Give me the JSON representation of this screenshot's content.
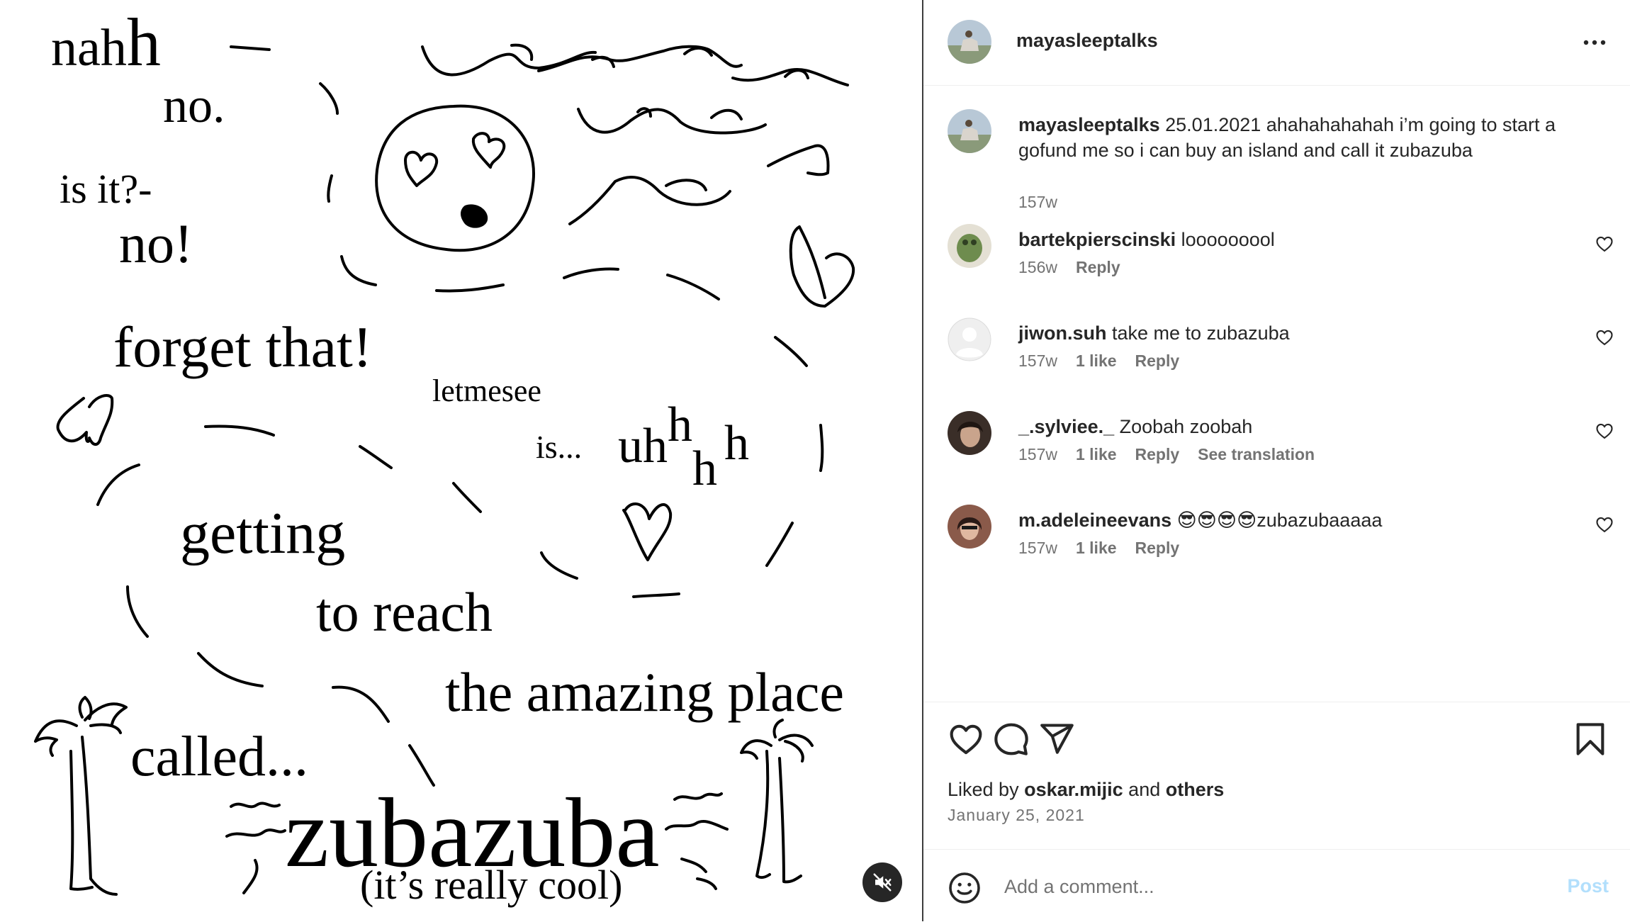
{
  "media": {
    "drawing_text": {
      "nahh_part1": "nah",
      "nahh_part2": "h",
      "no_1": "no.",
      "is_it": "is it?-",
      "no_2": "no!",
      "forget": "forget that!",
      "letmesee": "letmesee",
      "is": "is...",
      "uh_1": "uh",
      "uh_2": "h",
      "uh_3": "h",
      "uh_4": "h",
      "getting": "getting",
      "to_reach": "to reach",
      "amazing": "the amazing place",
      "called": "called...",
      "zubazuba": "zubazuba",
      "cool": "(it’s really cool)"
    },
    "mute_icon": "speaker-muted-icon"
  },
  "header": {
    "username": "mayasleeptalks",
    "more_icon": "more-options-icon"
  },
  "caption": {
    "username": "mayasleeptalks",
    "text": " 25.01.2021 ahahahahahah i’m going to start a gofund me so i can buy an island and call it zubazuba",
    "time": "157w"
  },
  "comments": [
    {
      "username": "bartekpierscinski",
      "text": " looooooool",
      "time": "156w",
      "likes": "",
      "reply": "Reply",
      "translation": ""
    },
    {
      "username": "jiwon.suh",
      "text": " take me to zubazuba",
      "time": "157w",
      "likes": "1 like",
      "reply": "Reply",
      "translation": ""
    },
    {
      "username": "_.sylviee._",
      "text": " Zoobah zoobah",
      "time": "157w",
      "likes": "1 like",
      "reply": "Reply",
      "translation": "See translation"
    },
    {
      "username": "m.adeleineevans",
      "text": " 😎😎😎😎zubazubaaaaa",
      "time": "157w",
      "likes": "1 like",
      "reply": "Reply",
      "translation": ""
    }
  ],
  "actions": {
    "like_icon": "heart-icon",
    "comment_icon": "comment-icon",
    "share_icon": "send-icon",
    "save_icon": "bookmark-icon"
  },
  "likes": {
    "prefix": "Liked by ",
    "user": "oskar.mijic",
    "middle": " and ",
    "others": "others"
  },
  "date": "January 25, 2021",
  "add_comment": {
    "placeholder": "Add a comment...",
    "post_label": "Post"
  },
  "colors": {
    "text_primary": "#262626",
    "text_secondary": "#737373",
    "post_disabled": "#b2dffc",
    "border": "#efefef"
  }
}
